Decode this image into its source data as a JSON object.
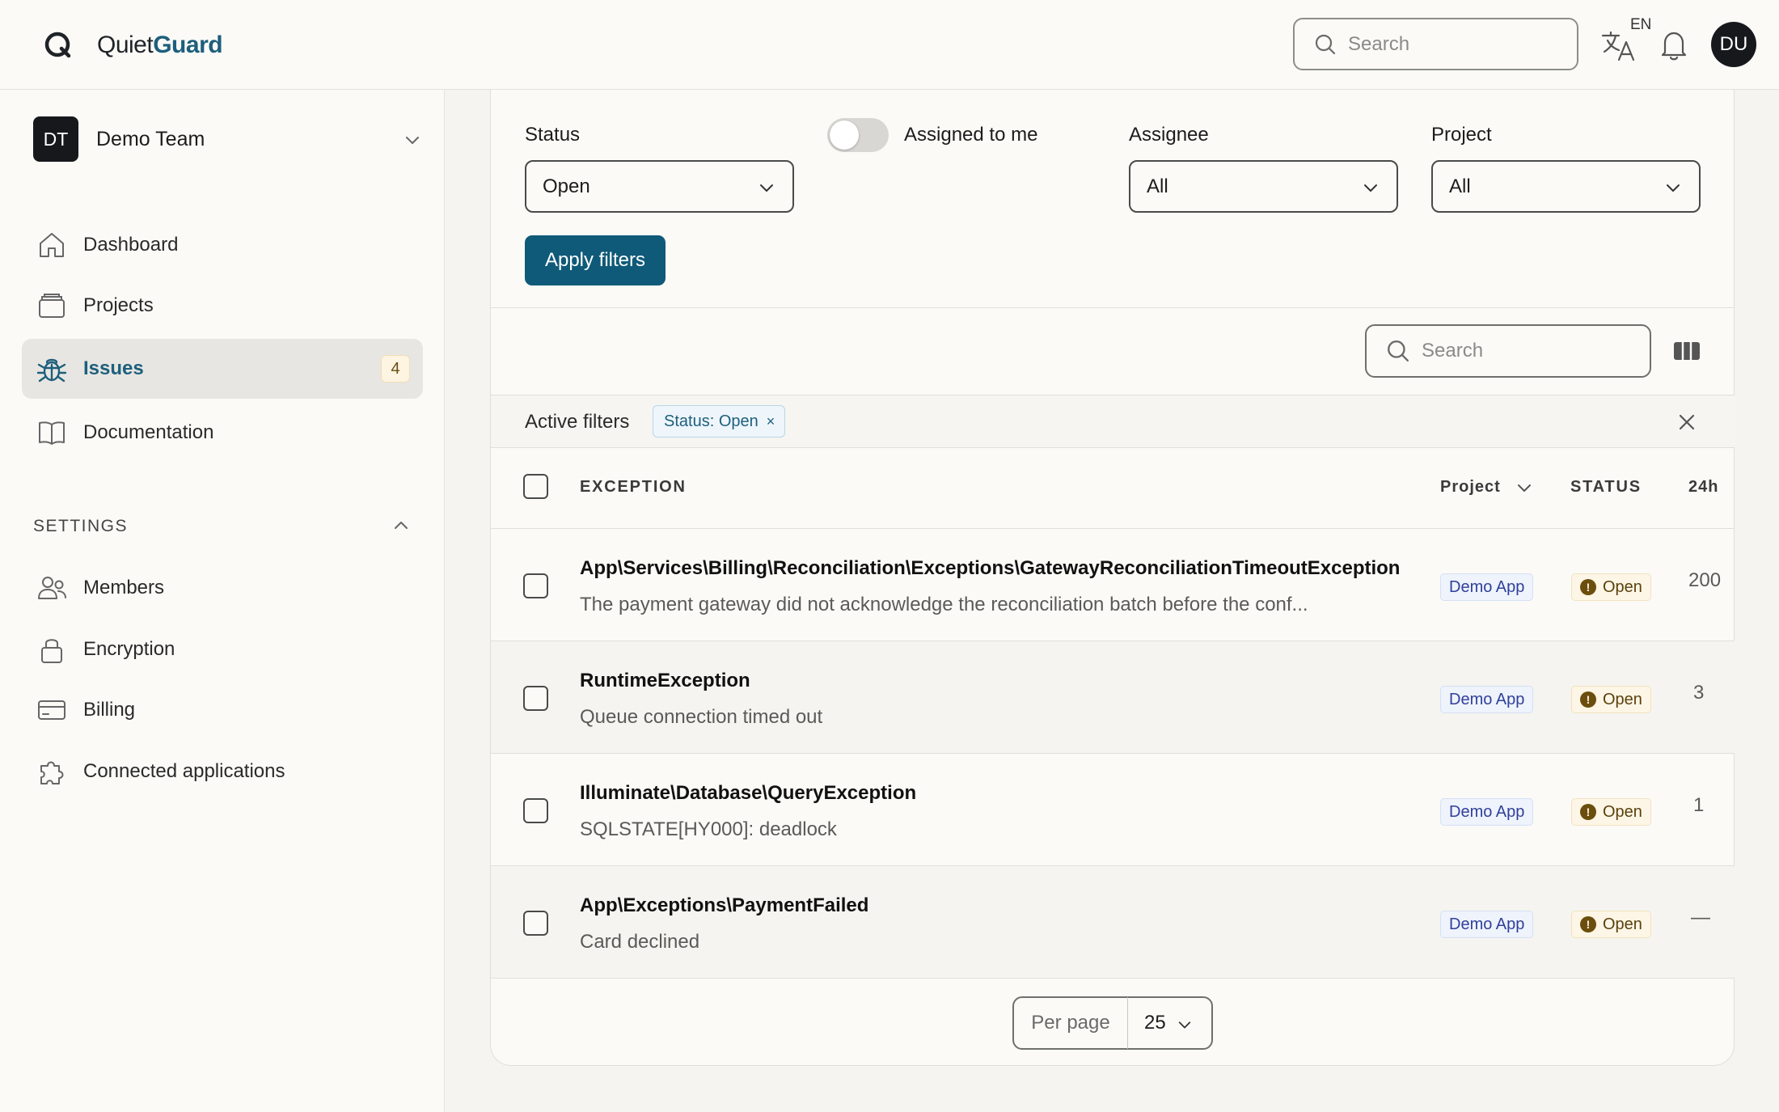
{
  "app": {
    "name_prefix": "Quiet",
    "name_suffix": "Guard",
    "search_placeholder": "Search",
    "language_code": "EN",
    "user_initials": "DU",
    "brand_color": "#1d5f7c"
  },
  "sidebar": {
    "team": {
      "initials": "DT",
      "name": "Demo Team"
    },
    "nav": [
      {
        "label": "Dashboard",
        "icon": "home-icon"
      },
      {
        "label": "Projects",
        "icon": "projects-icon"
      },
      {
        "label": "Issues",
        "icon": "bug-icon",
        "badge": "4",
        "active": true
      },
      {
        "label": "Documentation",
        "icon": "book-icon"
      }
    ],
    "settings_heading": "SETTINGS",
    "settings": [
      {
        "label": "Members",
        "icon": "members-icon"
      },
      {
        "label": "Encryption",
        "icon": "lock-icon"
      },
      {
        "label": "Billing",
        "icon": "credit-card-icon"
      },
      {
        "label": "Connected applications",
        "icon": "puzzle-icon"
      }
    ]
  },
  "filters": {
    "status_label": "Status",
    "status_value": "Open",
    "assigned_to_me_label": "Assigned to me",
    "assigned_to_me": false,
    "assignee_label": "Assignee",
    "assignee_value": "All",
    "project_label": "Project",
    "project_value": "All",
    "apply_label": "Apply filters"
  },
  "table": {
    "search_placeholder": "Search",
    "active_filters_label": "Active filters",
    "active_filter_chip": "Status: Open",
    "chip_remove": "×",
    "columns": {
      "exception": "EXCEPTION",
      "project": "Project",
      "status": "STATUS",
      "h24": "24h"
    },
    "rows": [
      {
        "title": "App\\Services\\Billing\\Reconciliation\\Exceptions\\GatewayReconciliationTimeoutException",
        "message": "The payment gateway did not acknowledge the reconciliation batch before the conf...",
        "project": "Demo App",
        "status": "Open",
        "count": "200"
      },
      {
        "title": "RuntimeException",
        "message": "Queue connection timed out",
        "project": "Demo App",
        "status": "Open",
        "count": "3"
      },
      {
        "title": "Illuminate\\Database\\QueryException",
        "message": "SQLSTATE[HY000]: deadlock",
        "project": "Demo App",
        "status": "Open",
        "count": "1"
      },
      {
        "title": "App\\Exceptions\\PaymentFailed",
        "message": "Card declined",
        "project": "Demo App",
        "status": "Open",
        "count": "—"
      }
    ],
    "per_page_label": "Per page",
    "per_page_value": "25"
  }
}
